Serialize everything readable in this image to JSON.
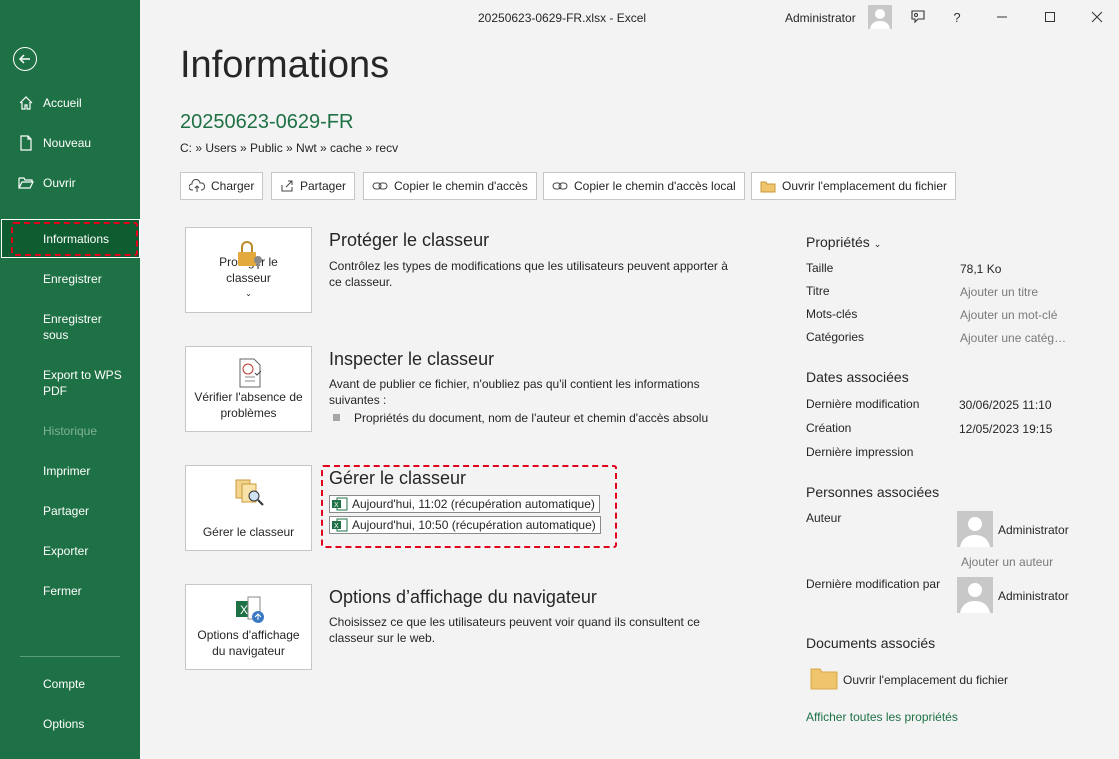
{
  "window": {
    "title": "20250623-0629-FR.xlsx  -  Excel",
    "user": "Administrator",
    "help": "?"
  },
  "sidebar": {
    "items": [
      {
        "label": "Accueil",
        "icon": "home-icon"
      },
      {
        "label": "Nouveau",
        "icon": "new-document-icon"
      },
      {
        "label": "Ouvrir",
        "icon": "open-folder-icon"
      },
      {
        "label": "Informations"
      },
      {
        "label": "Enregistrer"
      },
      {
        "label": "Enregistrer sous"
      },
      {
        "label": "Export to WPS PDF"
      },
      {
        "label": "Historique"
      },
      {
        "label": "Imprimer"
      },
      {
        "label": "Partager"
      },
      {
        "label": "Exporter"
      },
      {
        "label": "Fermer"
      },
      {
        "label": "Compte"
      },
      {
        "label": "Options"
      }
    ]
  },
  "main": {
    "title": "Informations",
    "file_name": "20250623-0629-FR",
    "path": "C: » Users » Public » Nwt » cache » recv",
    "actions": [
      {
        "label": "Charger",
        "icon": "upload-icon"
      },
      {
        "label": "Partager",
        "icon": "share-icon"
      },
      {
        "label": "Copier le chemin d'accès",
        "icon": "link-icon"
      },
      {
        "label": "Copier le chemin d'accès local",
        "icon": "link-icon"
      },
      {
        "label": "Ouvrir l'emplacement du fichier",
        "icon": "folder-icon"
      }
    ],
    "protect": {
      "button": "Protéger le classeur",
      "title": "Protéger le classeur",
      "desc": "Contrôlez les types de modifications que les utilisateurs peuvent apporter à ce classeur."
    },
    "inspect": {
      "button": "Vérifier l'absence de problèmes",
      "title": "Inspecter le classeur",
      "desc": "Avant de publier ce fichier, n'oubliez pas qu'il contient les informations suivantes :",
      "bullet": "Propriétés du document, nom de l'auteur et chemin d'accès absolu"
    },
    "manage": {
      "button": "Gérer le classeur",
      "title": "Gérer le classeur",
      "versions": [
        "Aujourd'hui, 11:02 (récupération automatique)",
        "Aujourd'hui, 10:50 (récupération automatique)"
      ]
    },
    "browser": {
      "button": "Options d'affichage du navigateur",
      "title": "Options d’affichage du navigateur",
      "desc": "Choisissez ce que les utilisateurs peuvent voir quand ils consultent ce classeur sur le web."
    }
  },
  "properties": {
    "heading": "Propriétés",
    "size_label": "Taille",
    "size_value": "78,1 Ko",
    "title_label": "Titre",
    "title_value": "Ajouter un titre",
    "keywords_label": "Mots-clés",
    "keywords_value": "Ajouter un mot-clé",
    "categories_label": "Catégories",
    "categories_value": "Ajouter une catég…",
    "dates_heading": "Dates associées",
    "modified_label": "Dernière modification",
    "modified_value": "30/06/2025 11:10",
    "created_label": "Création",
    "created_value": "12/05/2023 19:15",
    "printed_label": "Dernière impression",
    "people_heading": "Personnes associées",
    "author_label": "Auteur",
    "author_value": "Administrator",
    "add_author": "Ajouter un auteur",
    "last_modified_by_label": "Dernière modification par",
    "last_modified_by_value": "Administrator",
    "docs_heading": "Documents associés",
    "open_location": "Ouvrir l'emplacement du fichier",
    "show_all": "Afficher toutes les propriétés"
  }
}
